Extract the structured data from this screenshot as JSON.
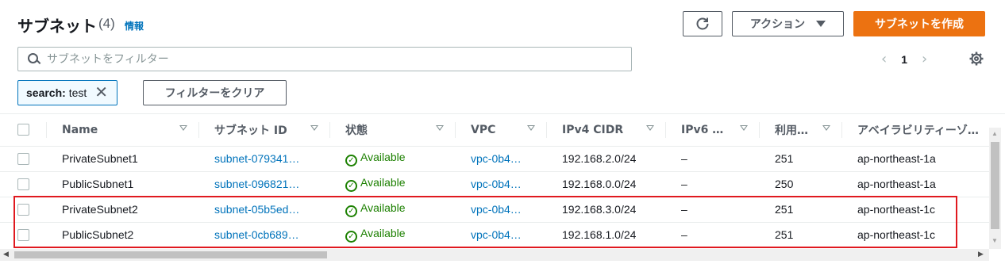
{
  "header": {
    "title": "サブネット",
    "count": "(4)",
    "info": "情報",
    "refresh_icon": "refresh-icon",
    "actions_label": "アクション",
    "create_label": "サブネットを作成"
  },
  "search": {
    "placeholder": "サブネットをフィルター",
    "value": ""
  },
  "pagination": {
    "prev": "‹",
    "page": "1",
    "next": "›"
  },
  "filter": {
    "token_key": "search:",
    "token_value": "test",
    "remove_icon": "close-icon",
    "clear_label": "フィルターをクリア"
  },
  "table": {
    "columns": [
      "Name",
      "サブネット ID",
      "状態",
      "VPC",
      "IPv4 CIDR",
      "IPv6 …",
      "利用…",
      "アベイラビリティーゾ…"
    ],
    "rows": [
      {
        "name": "PrivateSubnet1",
        "subnet_id": "subnet-079341…",
        "state": "Available",
        "vpc": "vpc-0b4…",
        "ipv4": "192.168.2.0/24",
        "ipv6": "–",
        "available": "251",
        "az": "ap-northeast-1a"
      },
      {
        "name": "PublicSubnet1",
        "subnet_id": "subnet-096821…",
        "state": "Available",
        "vpc": "vpc-0b4…",
        "ipv4": "192.168.0.0/24",
        "ipv6": "–",
        "available": "250",
        "az": "ap-northeast-1a"
      },
      {
        "name": "PrivateSubnet2",
        "subnet_id": "subnet-05b5ed…",
        "state": "Available",
        "vpc": "vpc-0b4…",
        "ipv4": "192.168.3.0/24",
        "ipv6": "–",
        "available": "251",
        "az": "ap-northeast-1c"
      },
      {
        "name": "PublicSubnet2",
        "subnet_id": "subnet-0cb689…",
        "state": "Available",
        "vpc": "vpc-0b4…",
        "ipv4": "192.168.1.0/24",
        "ipv6": "–",
        "available": "251",
        "az": "ap-northeast-1c"
      }
    ]
  },
  "colors": {
    "primary": "#ec7211",
    "link": "#0073bb",
    "available": "#1d8102",
    "highlight": "#e0191f"
  }
}
